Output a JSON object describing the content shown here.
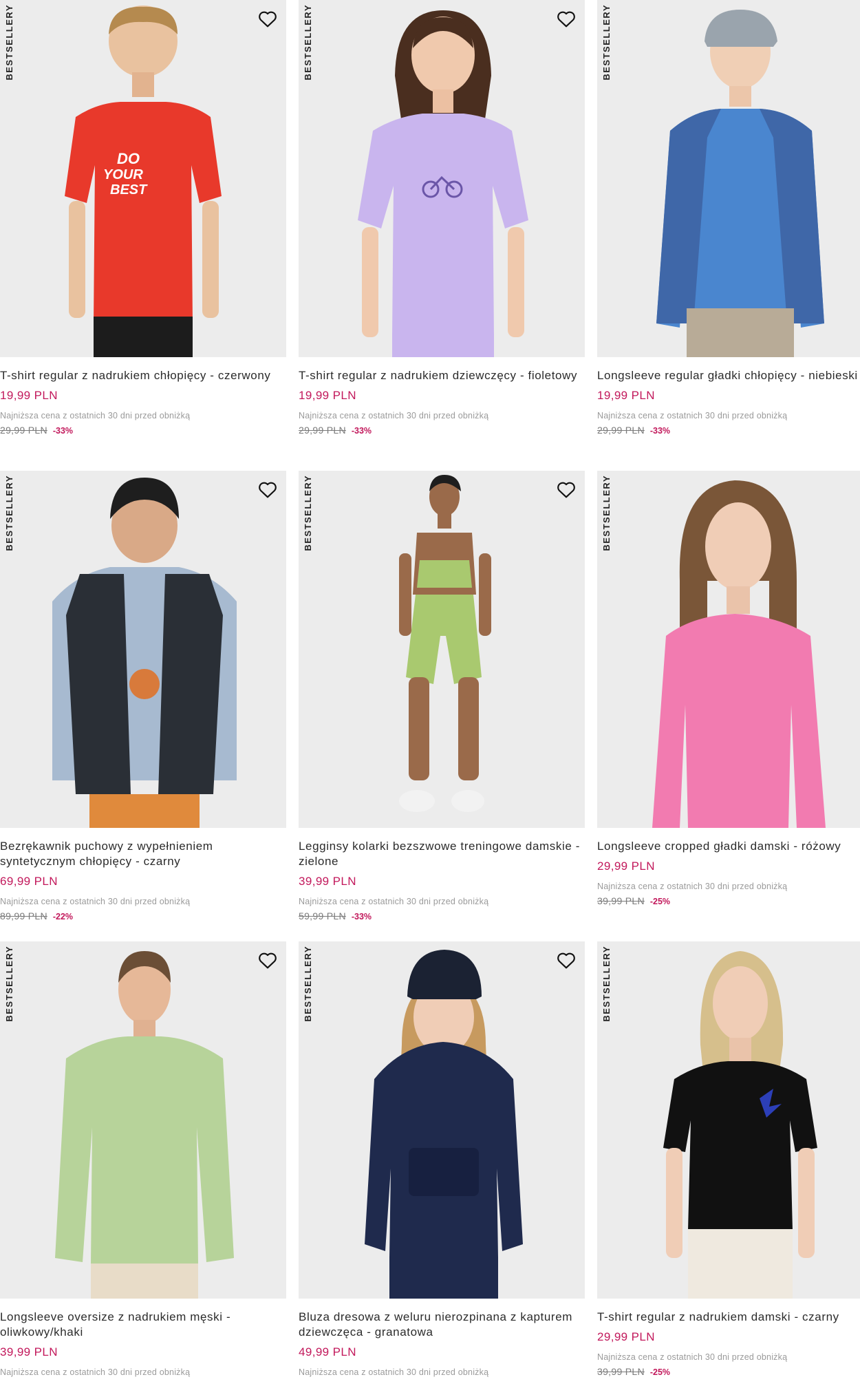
{
  "badge": "BESTSELLERY",
  "lowest_label": "Najniższa cena z ostatnich 30 dni przed obniżką",
  "products": [
    {
      "name": "T-shirt regular z nadrukiem chłopięcy - czerwony",
      "price": "19,99 PLN",
      "old_price": "29,99 PLN",
      "discount": "-33%"
    },
    {
      "name": "T-shirt regular z nadrukiem dziewczęcy - fioletowy",
      "price": "19,99 PLN",
      "old_price": "29,99 PLN",
      "discount": "-33%"
    },
    {
      "name": "Longsleeve regular gładki chłopięcy - niebieski",
      "price": "19,99 PLN",
      "old_price": "29,99 PLN",
      "discount": "-33%"
    },
    {
      "name": "Bezrękawnik puchowy z wypełnieniem syntetycznym chłopięcy - czarny",
      "price": "69,99 PLN",
      "old_price": "89,99 PLN",
      "discount": "-22%"
    },
    {
      "name": "Legginsy kolarki bezszwowe treningowe damskie - zielone",
      "price": "39,99 PLN",
      "old_price": "59,99 PLN",
      "discount": "-33%"
    },
    {
      "name": "Longsleeve cropped gładki damski - różowy",
      "price": "29,99 PLN",
      "old_price": "39,99 PLN",
      "discount": "-25%"
    },
    {
      "name": "Longsleeve oversize z nadrukiem męski - oliwkowy/khaki",
      "price": "39,99 PLN",
      "old_price": "",
      "discount": ""
    },
    {
      "name": "Bluza dresowa z weluru nierozpinana z kapturem dziewczęca - granatowa",
      "price": "49,99 PLN",
      "old_price": "",
      "discount": ""
    },
    {
      "name": "T-shirt regular z nadrukiem damski - czarny",
      "price": "29,99 PLN",
      "old_price": "39,99 PLN",
      "discount": "-25%"
    }
  ],
  "colors": {
    "price": "#c2185b",
    "image_bg": "#ececec",
    "garments": [
      "#e8392b",
      "#c9b5ee",
      "#4a86cf",
      "#2a2f36",
      "#a9c96f",
      "#f27bb0",
      "#b7d39a",
      "#1f2a4d",
      "#111111"
    ]
  },
  "icons": {
    "favorite": "heart-outline-icon"
  }
}
